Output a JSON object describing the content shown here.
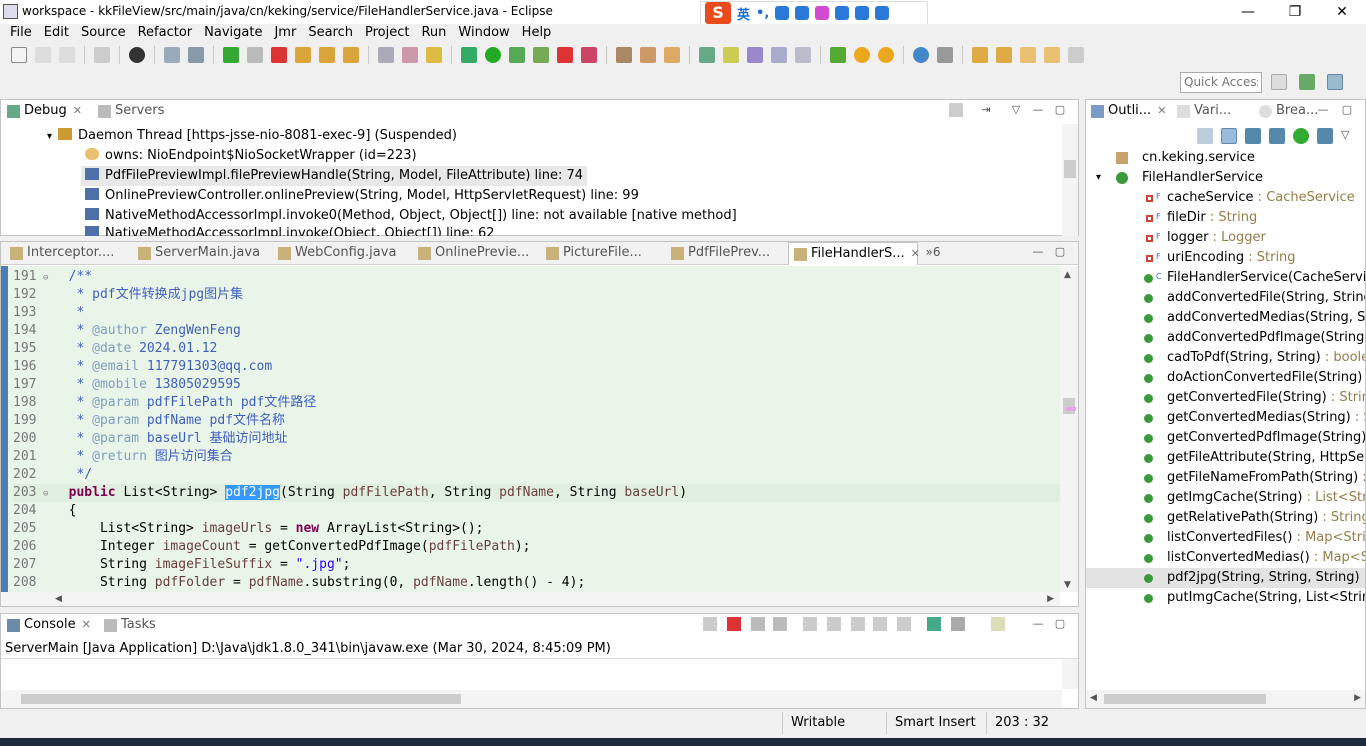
{
  "window": {
    "title": "workspace - kkFileView/src/main/java/cn/keking/service/FileHandlerService.java - Eclipse",
    "minimize": "—",
    "maximize": "❐",
    "close": "✕"
  },
  "ime": {
    "logo": "S",
    "lang": "英",
    "punct": "•,"
  },
  "menu": [
    "File",
    "Edit",
    "Source",
    "Refactor",
    "Navigate",
    "Jmr",
    "Search",
    "Project",
    "Run",
    "Window",
    "Help"
  ],
  "quick_access": "Quick Access",
  "debug_view": {
    "tabs": [
      {
        "label": "Debug",
        "close": "✕"
      },
      {
        "label": "Servers"
      }
    ],
    "tree": [
      {
        "text": "Daemon Thread [https-jsse-nio-8081-exec-9] (Suspended)"
      },
      {
        "text": "owns: NioEndpoint$NioSocketWrapper  (id=223)"
      },
      {
        "text": "PdfFilePreviewImpl.filePreviewHandle(String, Model, FileAttribute) line: 74"
      },
      {
        "text": "OnlinePreviewController.onlinePreview(String, Model, HttpServletRequest) line: 99"
      },
      {
        "text": "NativeMethodAccessorImpl.invoke0(Method, Object, Object[]) line: not available [native method]"
      },
      {
        "text": "NativeMethodAccessorImpl.invoke(Object, Object[]) line: 62"
      }
    ]
  },
  "editor": {
    "tabs": [
      {
        "label": "Interceptor...."
      },
      {
        "label": "ServerMain.java"
      },
      {
        "label": "WebConfig.java"
      },
      {
        "label": "OnlinePrevie..."
      },
      {
        "label": "PictureFile..."
      },
      {
        "label": "PdfFilePrev..."
      },
      {
        "label": "FileHandlerS...",
        "close": "✕"
      }
    ],
    "overflow": "»6",
    "line_numbers": [
      "191",
      "192",
      "193",
      "194",
      "195",
      "196",
      "197",
      "198",
      "199",
      "200",
      "201",
      "202",
      "203",
      "204",
      "205",
      "206",
      "207",
      "208"
    ],
    "code": {
      "l191": "/**",
      "l192": " * pdf文件转换成jpg图片集",
      "l193": " *",
      "l194_tag": "@author",
      "l194_text": " ZengWenFeng",
      "l195_tag": "@date",
      "l195_text": " 2024.01.12",
      "l196_tag": "@email",
      "l196_text": " 117791303@qq.com",
      "l197_tag": "@mobile",
      "l197_text": " 13805029595",
      "l198_tag": "@param",
      "l198_text": " pdfFilePath pdf文件路径",
      "l199_tag": "@param",
      "l199_text": " pdfName pdf文件名称",
      "l200_tag": "@param",
      "l200_text": " baseUrl 基础访问地址",
      "l201_tag": "@return",
      "l201_text": " 图片访问集合",
      "l202": " */",
      "l203_kw": "public",
      "l203_type": " List<String> ",
      "l203_name": "pdf2jpg",
      "l203_rest1": "(String ",
      "l203_p1": "pdfFilePath",
      "l203_rest2": ", String ",
      "l203_p2": "pdfName",
      "l203_rest3": ", String ",
      "l203_p3": "baseUrl",
      "l203_end": ")",
      "l204": "{",
      "l205_a": "List<String> ",
      "l205_v": "imageUrls",
      "l205_b": " = ",
      "l205_kw": "new",
      "l205_c": " ArrayList<String>();",
      "l206_a": "Integer ",
      "l206_v": "imageCount",
      "l206_b": " = getConvertedPdfImage(",
      "l206_p": "pdfFilePath",
      "l206_c": ");",
      "l207_a": "String ",
      "l207_v": "imageFileSuffix",
      "l207_b": " = ",
      "l207_s": "\".jpg\"",
      "l207_c": ";",
      "l208_a": "String ",
      "l208_v": "pdfFolder",
      "l208_b": " = ",
      "l208_p": "pdfName",
      "l208_c": ".substring(0, ",
      "l208_p2": "pdfName",
      "l208_d": ".length() - 4);"
    }
  },
  "outline_view": {
    "tabs": [
      {
        "label": "Outli...",
        "close": "✕"
      },
      {
        "label": "Vari..."
      },
      {
        "label": "Brea..."
      }
    ],
    "package": "cn.keking.service",
    "class": "FileHandlerService",
    "members": [
      {
        "name": "cacheService",
        "type": " : CacheService",
        "kind": "field"
      },
      {
        "name": "fileDir",
        "type": " : String",
        "kind": "field"
      },
      {
        "name": "logger",
        "type": " : Logger",
        "kind": "field"
      },
      {
        "name": "uriEncoding",
        "type": " : String",
        "kind": "field"
      },
      {
        "name": "FileHandlerService(CacheService)",
        "type": "",
        "kind": "ctor"
      },
      {
        "name": "addConvertedFile(String, String)",
        "type": " :",
        "kind": "method"
      },
      {
        "name": "addConvertedMedias(String, Strin",
        "type": "",
        "kind": "method"
      },
      {
        "name": "addConvertedPdfImage(String, int",
        "type": "",
        "kind": "method"
      },
      {
        "name": "cadToPdf(String, String)",
        "type": " : boolean",
        "kind": "method"
      },
      {
        "name": "doActionConvertedFile(String)",
        "type": " : vc",
        "kind": "method"
      },
      {
        "name": "getConvertedFile(String)",
        "type": " : String",
        "kind": "method"
      },
      {
        "name": "getConvertedMedias(String)",
        "type": " : Stri",
        "kind": "method"
      },
      {
        "name": "getConvertedPdfImage(String)",
        "type": " : Ir",
        "kind": "method"
      },
      {
        "name": "getFileAttribute(String, HttpServlet",
        "type": "",
        "kind": "method"
      },
      {
        "name": "getFileNameFromPath(String)",
        "type": " : Str",
        "kind": "method"
      },
      {
        "name": "getImgCache(String)",
        "type": " : List<String>",
        "kind": "method"
      },
      {
        "name": "getRelativePath(String)",
        "type": " : String",
        "kind": "method"
      },
      {
        "name": "listConvertedFiles()",
        "type": " : Map<String,",
        "kind": "method"
      },
      {
        "name": "listConvertedMedias()",
        "type": " : Map<Strin",
        "kind": "method"
      },
      {
        "name": "pdf2jpg(String, String, String)",
        "type": " : Lis",
        "kind": "method"
      },
      {
        "name": "putImgCache(String, List<String>)",
        "type": "",
        "kind": "method"
      }
    ]
  },
  "console_view": {
    "tabs": [
      {
        "label": "Console",
        "close": "✕"
      },
      {
        "label": "Tasks"
      }
    ],
    "process": "ServerMain [Java Application] D:\\Java\\jdk1.8.0_341\\bin\\javaw.exe (Mar 30, 2024, 8:45:09 PM)"
  },
  "status": {
    "writable": "Writable",
    "insert_mode": "Smart Insert",
    "position": "203 : 32"
  },
  "colors": {
    "editor_bg": "#e9f5e9",
    "comment": "#3f5fbf",
    "keyword": "#7f0055",
    "selection": "#3399ff"
  }
}
